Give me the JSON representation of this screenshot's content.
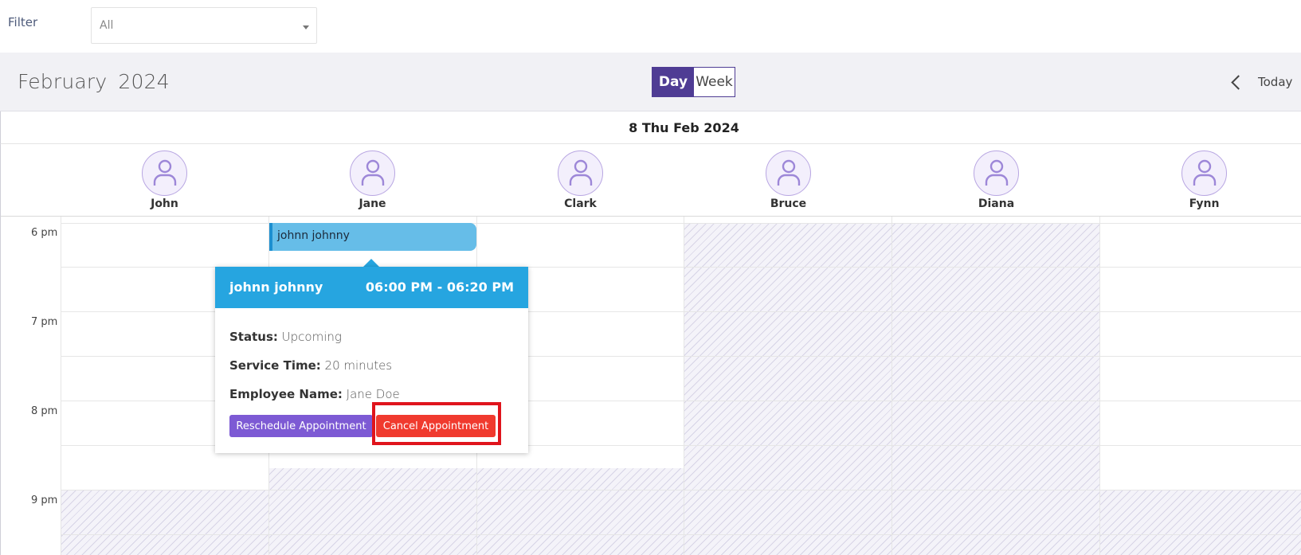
{
  "filter": {
    "label": "Filter",
    "value": "All"
  },
  "toolbar": {
    "month": "February",
    "year": "2024",
    "views": [
      {
        "label": "Day",
        "active": true
      },
      {
        "label": "Week",
        "active": false
      }
    ],
    "today_label": "Today"
  },
  "date_header": "8 Thu Feb 2024",
  "resources": [
    "John",
    "Jane",
    "Clark",
    "Bruce",
    "Diana",
    "Fynn"
  ],
  "time_labels": [
    "6 pm",
    "7 pm",
    "8 pm",
    "9 pm"
  ],
  "event": {
    "title": "johnn johnny",
    "resource": "Jane"
  },
  "popup": {
    "name": "johnn johnny",
    "time": "06:00 PM - 06:20 PM",
    "status_label": "Status:",
    "status_value": "Upcoming",
    "service_label": "Service Time:",
    "service_value": "20 minutes",
    "employee_label": "Employee Name:",
    "employee_value": "Jane Doe",
    "reschedule_label": "Reschedule Appointment",
    "cancel_label": "Cancel Appointment"
  },
  "colors": {
    "primary": "#4f3c94",
    "event": "#66bde8",
    "popup_header": "#26a5e0",
    "reschedule": "#7d5ad4",
    "cancel": "#f03a2e",
    "highlight": "#e0141c"
  }
}
